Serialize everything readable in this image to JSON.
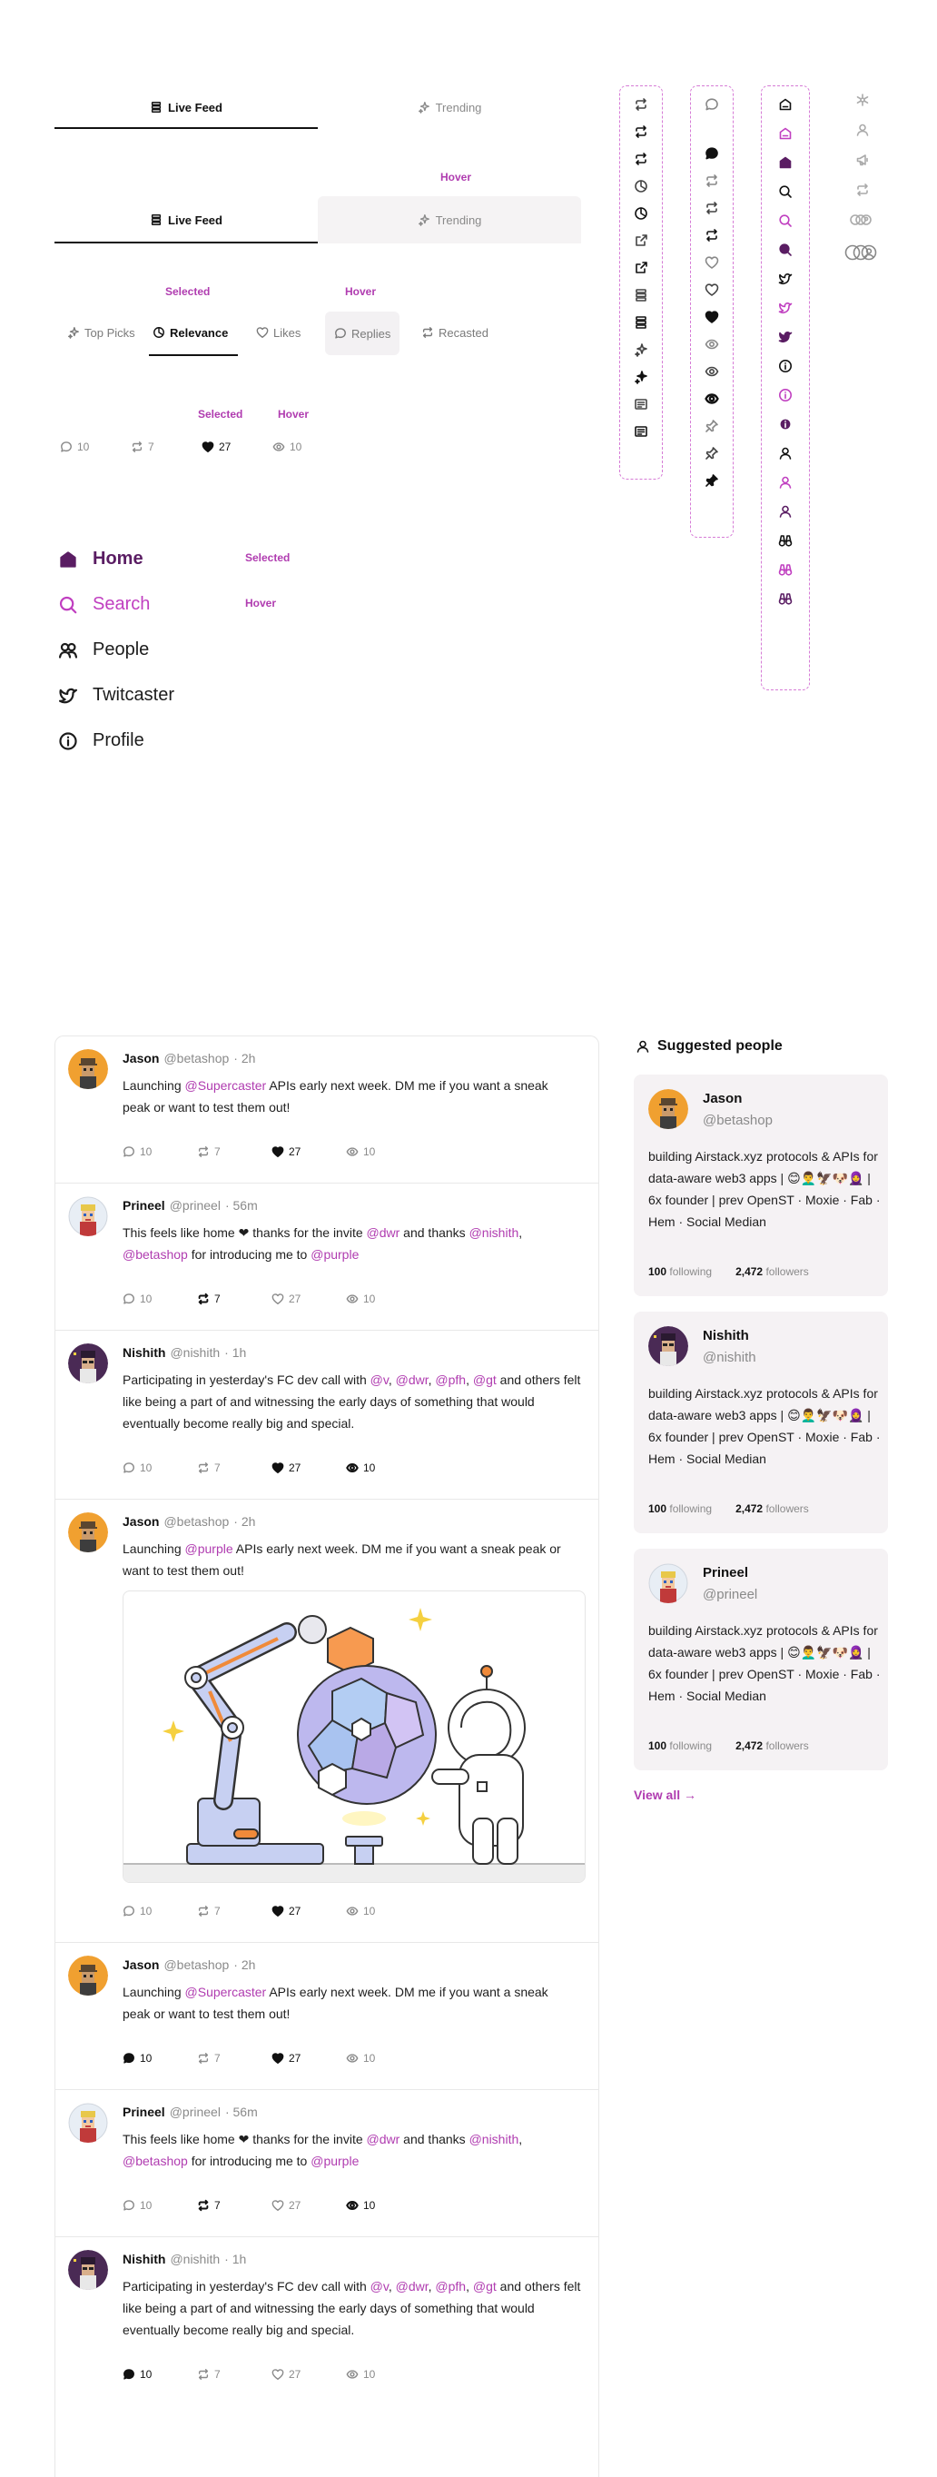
{
  "tabs_default": {
    "live_feed": "Live Feed",
    "trending": "Trending"
  },
  "tabs_hover": {
    "label": "Hover",
    "live_feed": "Live Feed",
    "trending": "Trending"
  },
  "sort_chips": {
    "selected_label": "Selected",
    "hover_label": "Hover",
    "items": [
      "Top Picks",
      "Relevance",
      "Likes",
      "Replies",
      "Recasted"
    ]
  },
  "stats_demo": {
    "selected_label": "Selected",
    "hover_label": "Hover",
    "replies": "10",
    "recasts": "7",
    "likes": "27",
    "views": "10"
  },
  "nav_menu": {
    "selected_label": "Selected",
    "hover_label": "Hover",
    "items": [
      "Home",
      "Search",
      "People",
      "Twitcaster",
      "Profile"
    ]
  },
  "posts": [
    {
      "name": "Jason",
      "handle": "@betashop",
      "time": "· 2h",
      "text_a": "Launching ",
      "mention1": "@Supercaster",
      "text_b": " APIs early next week. DM me if you want a sneak peak or want to test them out!",
      "replies": "10",
      "recasts": "7",
      "likes": "27",
      "views": "10"
    },
    {
      "name": "Prineel",
      "handle": "@prineel",
      "time": "· 56m",
      "text_a": "This feels like home ❤ thanks for the invite ",
      "mention1": "@dwr",
      "text_b": " and thanks ",
      "mention2": "@nishith",
      "text_c": ",",
      "mention3": "@betashop",
      "text_d": " for introducing me to ",
      "mention4": "@purple",
      "replies": "10",
      "recasts": "7",
      "likes": "27",
      "views": "10"
    },
    {
      "name": "Nishith",
      "handle": "@nishith",
      "time": "· 1h",
      "text_a": "Participating in yesterday's FC dev call with ",
      "m1": "@v",
      "sep1": ", ",
      "m2": "@dwr",
      "sep2": ", ",
      "m3": "@pfh",
      "sep3": ", ",
      "m4": "@gt",
      "text_b": " and others felt like being a part of and witnessing the early days of something that would eventually become really big and special.",
      "replies": "10",
      "recasts": "7",
      "likes": "27",
      "views": "10"
    },
    {
      "name": "Jason",
      "handle": "@betashop",
      "time": "· 2h",
      "text_a": "Launching ",
      "mention1": "@purple",
      "text_b": " APIs early next week. DM me if you want a sneak peak or want to test them out!",
      "replies": "10",
      "recasts": "7",
      "likes": "27",
      "views": "10"
    },
    {
      "name": "Jason",
      "handle": "@betashop",
      "time": "· 2h",
      "text_a": "Launching ",
      "mention1": "@Supercaster",
      "text_b": " APIs early next week. DM me if you want a sneak peak or want to test them out!",
      "replies": "10",
      "recasts": "7",
      "likes": "27",
      "views": "10"
    },
    {
      "name": "Prineel",
      "handle": "@prineel",
      "time": "· 56m",
      "text_a": "This feels like home ❤ thanks for the invite ",
      "mention1": "@dwr",
      "text_b": " and thanks ",
      "mention2": "@nishith",
      "text_c": ",",
      "mention3": "@betashop",
      "text_d": " for introducing me to ",
      "mention4": "@purple",
      "replies": "10",
      "recasts": "7",
      "likes": "27",
      "views": "10"
    },
    {
      "name": "Nishith",
      "handle": "@nishith",
      "time": "· 1h",
      "text_a": "Participating in yesterday's FC dev call with ",
      "m1": "@v",
      "sep1": ", ",
      "m2": "@dwr",
      "sep2": ", ",
      "m3": "@pfh",
      "sep3": ", ",
      "m4": "@gt",
      "text_b": " and others felt like being a part of and witnessing the early days of something that would eventually become really big and special.",
      "replies": "10",
      "recasts": "7",
      "likes": "27",
      "views": "10"
    }
  ],
  "suggested": {
    "title": "Suggested people",
    "view_all": "View all →",
    "following_label": "following",
    "followers_label": "followers",
    "people": [
      {
        "name": "Jason",
        "handle": "@betashop",
        "bio": "building Airstack.xyz protocols & APIs for data-aware web3 apps | 😊👨‍🦱🦅🐶🧕 | 6x founder | prev OpenST · Moxie · Fab · Hem · Social Median",
        "following": "100",
        "followers": "2,472"
      },
      {
        "name": "Nishith",
        "handle": "@nishith",
        "bio": "building Airstack.xyz protocols & APIs for data-aware web3 apps | 😊👨‍🦱🦅🐶🧕 | 6x founder | prev OpenST · Moxie · Fab · Hem · Social Median",
        "following": "100",
        "followers": "2,472"
      },
      {
        "name": "Prineel",
        "handle": "@prineel",
        "bio": "building Airstack.xyz protocols & APIs for data-aware web3 apps | 😊👨‍🦱🦅🐶🧕 | 6x founder | prev OpenST · Moxie · Fab · Hem · Social Median",
        "following": "100",
        "followers": "2,472"
      }
    ]
  },
  "colors": {
    "accent": "#b03cb0",
    "selected": "#5a1d63",
    "border": "#e8e8e8",
    "card_bg": "#f5f2f4"
  }
}
